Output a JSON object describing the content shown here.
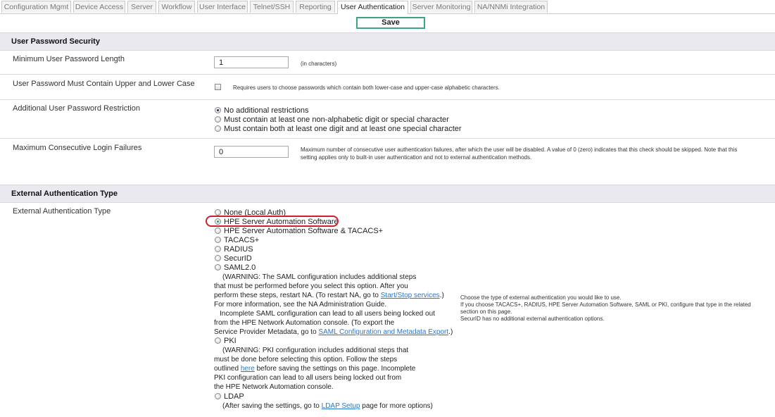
{
  "tabs": [
    {
      "label": "Configuration Mgmt",
      "active": false
    },
    {
      "label": "Device Access",
      "active": false
    },
    {
      "label": "Server",
      "active": false
    },
    {
      "label": "Workflow",
      "active": false
    },
    {
      "label": "User Interface",
      "active": false
    },
    {
      "label": "Telnet/SSH",
      "active": false
    },
    {
      "label": "Reporting",
      "active": false
    },
    {
      "label": "User Authentication",
      "active": true
    },
    {
      "label": "Server Monitoring",
      "active": false
    },
    {
      "label": "NA/NNMi Integration",
      "active": false
    }
  ],
  "save_label": "Save",
  "password_section": {
    "title": "User Password Security",
    "min_length": {
      "label": "Minimum User Password Length",
      "value": "1",
      "unit": "(in characters)"
    },
    "upper_lower": {
      "label": "User Password Must Contain Upper and Lower Case",
      "checked": false,
      "hint": "Requires users to choose passwords which contain both lower-case and upper-case alphabetic characters."
    },
    "restriction": {
      "label": "Additional User Password Restriction",
      "options": [
        "No additional restrictions",
        "Must contain at least one non-alphabetic digit or special character",
        "Must contain both at least one digit and at least one special character"
      ],
      "selected_index": 0
    },
    "login_failures": {
      "label": "Maximum Consecutive Login Failures",
      "value": "0",
      "hint_line1": "Maximum number of consecutive user authentication failures, after which the user will be disabled. A value of 0 (zero) indicates that this check should be skipped. Note that this",
      "hint_line2": "setting applies only to built-in user authentication and not to external authentication methods."
    }
  },
  "external_section": {
    "title": "External Authentication Type",
    "label": "External Authentication Type",
    "options": [
      "None (Local Auth)",
      "HPE Server Automation Software",
      "HPE Server Automation Software & TACACS+",
      "TACACS+",
      "RADIUS",
      "SecurID",
      "SAML2.0",
      "PKI",
      "LDAP"
    ],
    "selected_index": 1,
    "saml_text": {
      "l1": "(WARNING: The SAML configuration includes additional steps",
      "l2": "that must be performed before you select this option. After you",
      "l3_pre": "perform these steps, restart NA. (To restart NA, go to ",
      "l3_link": "Start/Stop services",
      "l3_post": ".)",
      "l4": "For more information, see the NA Administration Guide.",
      "l5": "Incomplete SAML configuration can lead to all users being locked out",
      "l6": "from the HPE Network Automation console. (To export the",
      "l7_pre": "Service Provider Metadata, go to ",
      "l7_link": "SAML Configuration and Metadata Export",
      "l7_post": ".)"
    },
    "pki_text": {
      "l1": "(WARNING: PKI configuration includes additional steps that",
      "l2": "must be done before selecting this option. Follow the steps",
      "l3_pre": "outlined ",
      "l3_link": "here",
      "l3_post": " before saving the settings on this page. Incomplete",
      "l4": "PKI configuration can lead to all users being locked out from",
      "l5": "the HPE Network Automation console."
    },
    "ldap_text": {
      "pre": "(After saving the settings, go to ",
      "link": "LDAP Setup",
      "post": " page for more options)"
    },
    "right_note": {
      "l1": "Choose the type of external authentication you would like to use.",
      "l2": "If you choose TACACS+, RADIUS, HPE Server Automation Software, SAML or PKI, configure that type in the related",
      "l3": "section on this page.",
      "l4": "SecurID has no additional external authentication options."
    }
  },
  "colors": {
    "section_bg": "#e9e9ef",
    "save_border": "#3aa687",
    "highlight": "#d01f2c",
    "link": "#2a77c9"
  }
}
